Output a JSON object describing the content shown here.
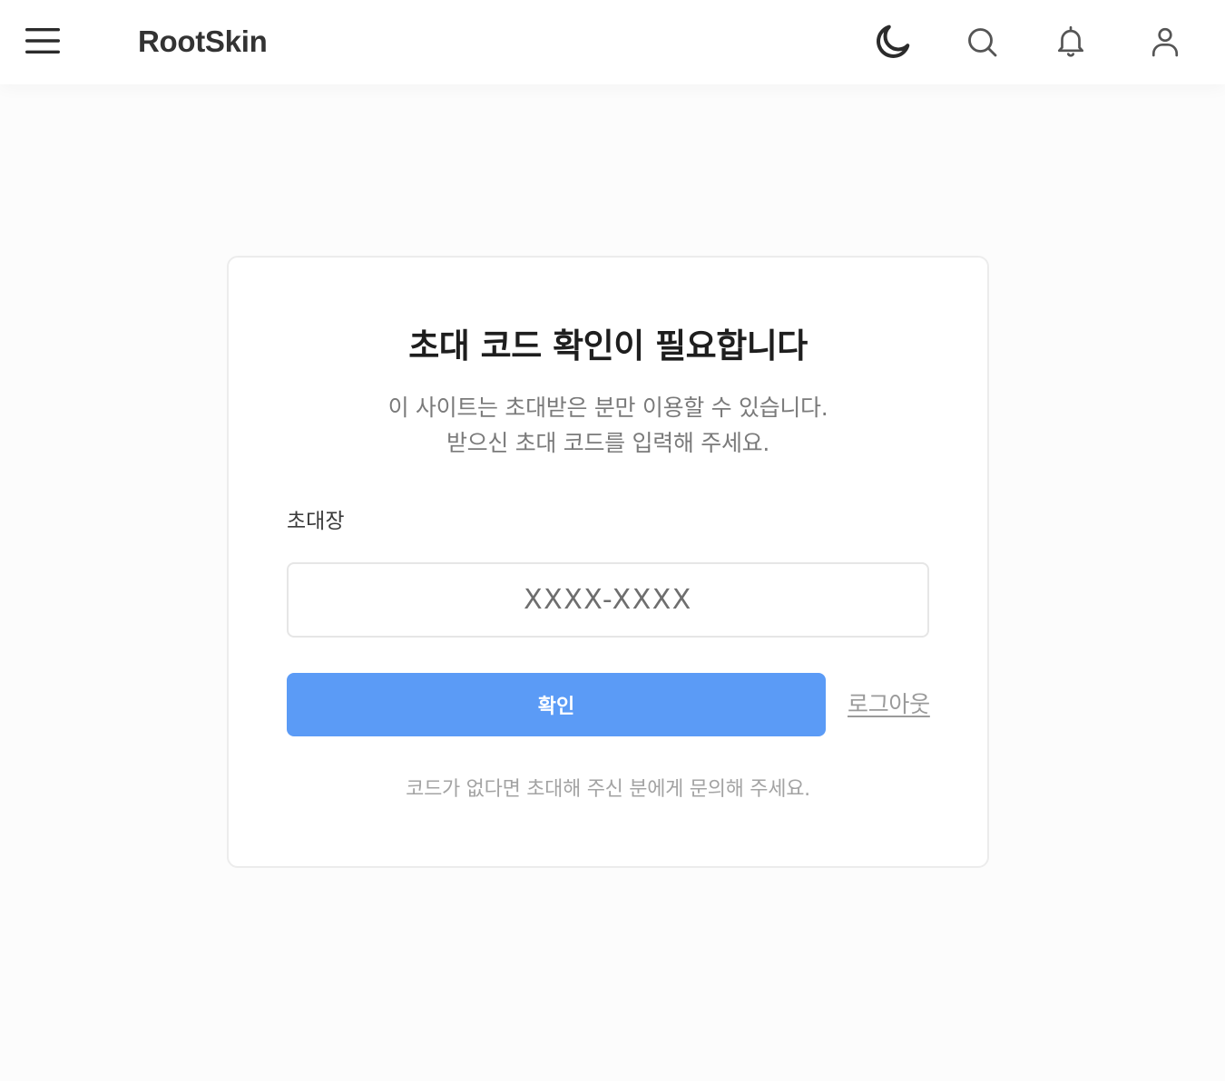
{
  "header": {
    "logo": "RootSkin",
    "icons": {
      "menu": "hamburger-menu-icon",
      "theme": "moon-icon",
      "search": "search-icon",
      "notifications": "bell-icon",
      "account": "user-icon"
    }
  },
  "invite": {
    "title": "초대 코드 확인이 필요합니다",
    "description_line1": "이 사이트는 초대받은 분만 이용할 수 있습니다.",
    "description_line2": "받으신 초대 코드를 입력해 주세요.",
    "field_label": "초대장",
    "code_value": "",
    "code_placeholder": "XXXX-XXXX",
    "confirm_label": "확인",
    "logout_label": "로그아웃",
    "footer_note": "코드가 없다면 초대해 주신 분에게 문의해 주세요."
  },
  "colors": {
    "accent": "#5b9bf6",
    "text_primary": "#1e1e1e",
    "text_muted": "#7a7a7a",
    "border": "#ececec"
  }
}
